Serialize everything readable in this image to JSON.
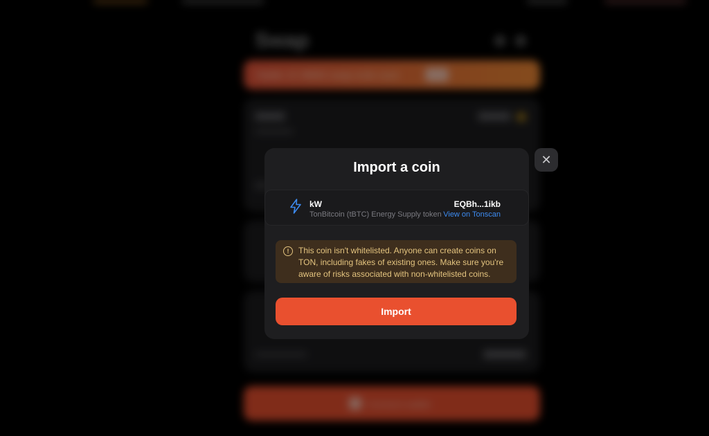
{
  "background": {
    "page_title": "Swap",
    "banner_text": "Stable 15 38684 swap ends soon",
    "action_button_label": "Connect wallet"
  },
  "modal": {
    "title": "Import a coin",
    "close_icon": "close-icon",
    "coin": {
      "icon": "lightning-icon",
      "symbol": "kW",
      "name": "TonBitcoin (tBTC) Energy Supply token",
      "address": "EQBh...1ikb",
      "explorer_link": "View on Tonscan"
    },
    "warning": {
      "icon": "info-icon",
      "text": "This coin isn't whitelisted. Anyone can create coins on TON, including fakes of existing ones. Make sure you're aware of risks associated with non-whitelisted coins."
    },
    "import_button_label": "Import"
  },
  "colors": {
    "accent": "#e9502f",
    "link": "#3d8bf0",
    "warning_text": "#e4c47f",
    "warning_bg": "#3e2e1d",
    "modal_bg": "#1e1e20"
  }
}
